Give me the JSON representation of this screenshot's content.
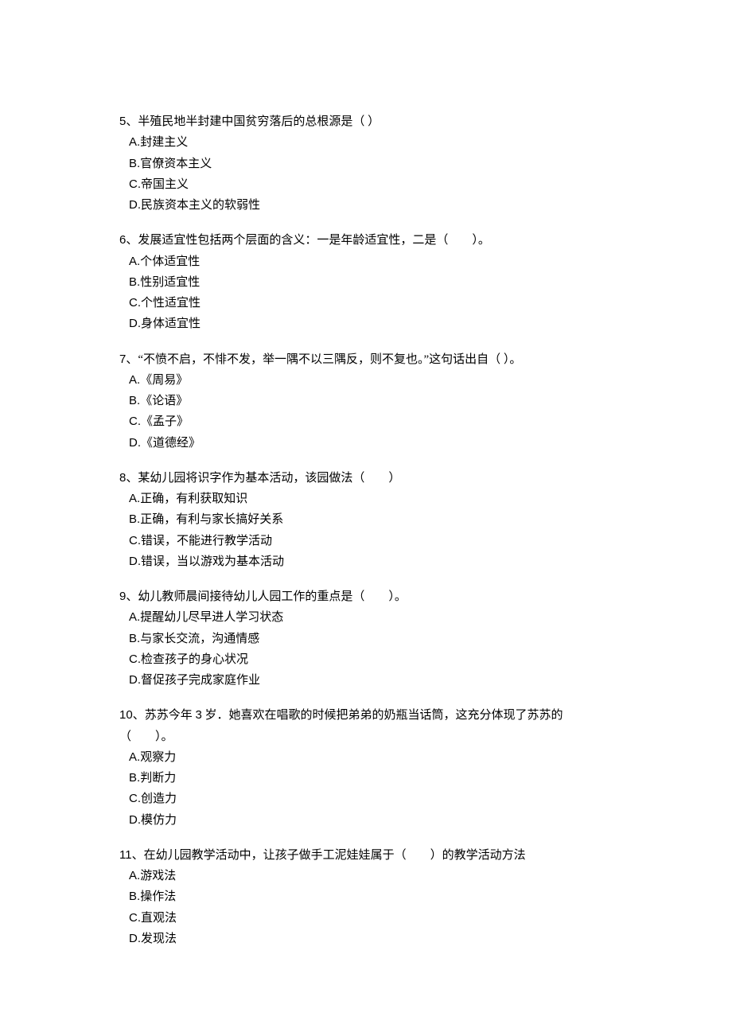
{
  "questions": [
    {
      "num": "5",
      "stem": "、半殖民地半封建中国贫穷落后的总根源是（ ）",
      "options": [
        {
          "letter": "A.",
          "text": "封建主义"
        },
        {
          "letter": "B.",
          "text": "官僚资本主义"
        },
        {
          "letter": "C.",
          "text": "帝国主义"
        },
        {
          "letter": "D.",
          "text": "民族资本主义的软弱性"
        }
      ]
    },
    {
      "num": "6",
      "stem": "、发展适宜性包括两个层面的含义：一是年龄适宜性，二是（　　）。",
      "options": [
        {
          "letter": "A.",
          "text": "个体适宜性"
        },
        {
          "letter": "B.",
          "text": "性别适宜性"
        },
        {
          "letter": "C.",
          "text": "个性适宜性"
        },
        {
          "letter": "D.",
          "text": "身体适宜性"
        }
      ]
    },
    {
      "num": "7",
      "stem": "、“不愤不启，不悱不发，举一隅不以三隅反，则不复也。”这句话出自（ ）。",
      "options": [
        {
          "letter": "A.",
          "text": "《周易》"
        },
        {
          "letter": "B.",
          "text": "《论语》"
        },
        {
          "letter": "C.",
          "text": "《孟子》"
        },
        {
          "letter": "D.",
          "text": "《道德经》"
        }
      ]
    },
    {
      "num": "8",
      "stem": "、某幼儿园将识字作为基本活动，该园做法（　　）",
      "options": [
        {
          "letter": "A.",
          "text": "正确，有利获取知识"
        },
        {
          "letter": "B.",
          "text": "正确，有利与家长搞好关系"
        },
        {
          "letter": "C.",
          "text": "错误，不能进行教学活动"
        },
        {
          "letter": "D.",
          "text": "错误，当以游戏为基本活动"
        }
      ]
    },
    {
      "num": "9",
      "stem": "、幼儿教师晨间接待幼儿人园工作的重点是（　　）。",
      "options": [
        {
          "letter": "A.",
          "text": "提醒幼儿尽早进人学习状态"
        },
        {
          "letter": "B.",
          "text": "与家长交流，沟通情感"
        },
        {
          "letter": "C.",
          "text": "检查孩子的身心状况"
        },
        {
          "letter": "D.",
          "text": "督促孩子完成家庭作业"
        }
      ]
    },
    {
      "num": "10",
      "stem_prefix": "、苏苏今年 ",
      "age": "3",
      "stem_suffix": " 岁．她喜欢在唱歌的时候把弟弟的奶瓶当话筒，这充分体现了苏苏的",
      "stem_line2": "（　　）。",
      "options": [
        {
          "letter": "A.",
          "text": "观察力"
        },
        {
          "letter": "B.",
          "text": "判断力"
        },
        {
          "letter": "C.",
          "text": "创造力"
        },
        {
          "letter": "D.",
          "text": "模仿力"
        }
      ]
    },
    {
      "num": "11",
      "stem": "、在幼儿园教学活动中，让孩子做手工泥娃娃属于（　　）的教学活动方法",
      "options": [
        {
          "letter": "A.",
          "text": "游戏法"
        },
        {
          "letter": "B.",
          "text": "操作法"
        },
        {
          "letter": "C.",
          "text": "直观法"
        },
        {
          "letter": "D.",
          "text": "发现法"
        }
      ]
    }
  ]
}
